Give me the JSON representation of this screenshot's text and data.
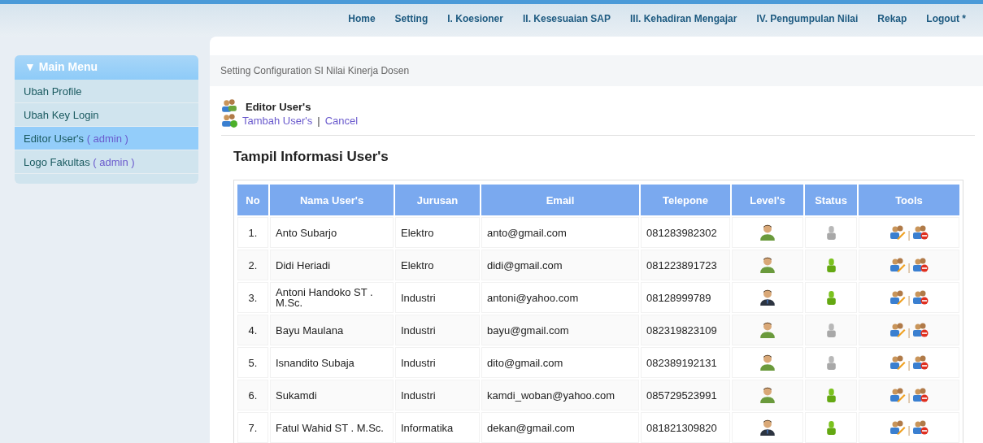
{
  "nav": [
    {
      "label": "Home"
    },
    {
      "label": "Setting"
    },
    {
      "label": "I. Koesioner"
    },
    {
      "label": "II. Kesesuaian SAP"
    },
    {
      "label": "III. Kehadiran Mengajar"
    },
    {
      "label": "IV. Pengumpulan Nilai"
    },
    {
      "label": "Rekap"
    },
    {
      "label": "Logout *"
    }
  ],
  "sidebar": {
    "title": "▼ Main Menu",
    "items": [
      {
        "label": "Ubah Profile",
        "selected": false
      },
      {
        "label": "Ubah Key Login",
        "selected": false
      },
      {
        "label": "Editor User's",
        "note": "( admin )",
        "selected": true
      },
      {
        "label": "Logo Fakultas",
        "note": "( admin )",
        "selected": false
      }
    ]
  },
  "breadcrumb": "Setting Configuration SI Nilai Kinerja Dosen",
  "editor": {
    "title": "Editor User's",
    "links": [
      "Tambah User's",
      "Cancel"
    ],
    "separator": "|"
  },
  "fieldset_title": "Tampil Informasi User's",
  "table": {
    "columns": [
      "No",
      "Nama User's",
      "Jurusan",
      "Email",
      "Telepone",
      "Level's",
      "Status",
      "Tools"
    ],
    "rows": [
      {
        "no": "1.",
        "name": "Anto Subarjo",
        "jurusan": "Elektro",
        "email": "anto@gmail.com",
        "phone": "081283982302",
        "admin": false,
        "active": false
      },
      {
        "no": "2.",
        "name": "Didi Heriadi",
        "jurusan": "Elektro",
        "email": "didi@gmail.com",
        "phone": "081223891723",
        "admin": false,
        "active": true
      },
      {
        "no": "3.",
        "name": "Antoni Handoko ST . M.Sc.",
        "jurusan": "Industri",
        "email": "antoni@yahoo.com",
        "phone": "08128999789",
        "admin": true,
        "active": true
      },
      {
        "no": "4.",
        "name": "Bayu Maulana",
        "jurusan": "Industri",
        "email": "bayu@gmail.com",
        "phone": "082319823109",
        "admin": false,
        "active": false
      },
      {
        "no": "5.",
        "name": "Isnandito Subaja",
        "jurusan": "Industri",
        "email": "dito@gmail.com",
        "phone": "082389192131",
        "admin": false,
        "active": false
      },
      {
        "no": "6.",
        "name": "Sukamdi",
        "jurusan": "Industri",
        "email": "kamdi_woban@yahoo.com",
        "phone": "085729523991",
        "admin": false,
        "active": true
      },
      {
        "no": "7.",
        "name": "Fatul Wahid ST . M.Sc.",
        "jurusan": "Informatika",
        "email": "dekan@gmail.com",
        "phone": "081821309820",
        "admin": true,
        "active": true
      }
    ],
    "tool_separator": "|"
  }
}
